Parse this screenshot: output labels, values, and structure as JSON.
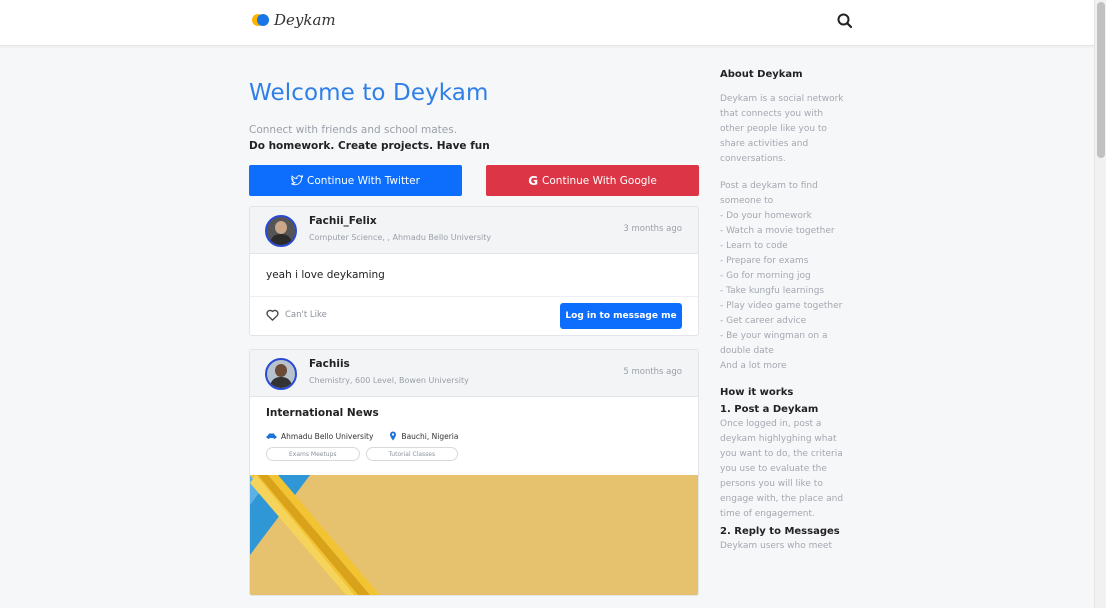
{
  "brand": {
    "name": "Deykam"
  },
  "header": {
    "search_icon": "search-icon"
  },
  "hero": {
    "title": "Welcome to Deykam",
    "tagline": "Connect with friends and school mates.",
    "tagline_bold": "Do homework. Create projects. Have fun"
  },
  "auth": {
    "twitter_label": "Continue With Twitter",
    "google_label": "Continue With Google"
  },
  "posts": [
    {
      "username": "Fachii_Felix",
      "meta": "Computer Science, , Ahmadu Bello University",
      "time": "3 months ago",
      "text": "yeah i love deykaming",
      "like_label": "Can't Like",
      "message_label": "Log in to message me"
    },
    {
      "username": "Fachiis",
      "meta": "Chemistry, 600 Level, Bowen University",
      "time": "5 months ago",
      "title": "International News",
      "school": "Ahmadu Bello University",
      "location": "Bauchi, Nigeria",
      "tags": [
        "Exams Meetups",
        "Tutorial Classes"
      ]
    }
  ],
  "sidebar": {
    "about_title": "About Deykam",
    "about_text": "Deykam is a social network that connects you with other people like you to share activities and conversations.",
    "post_intro": "Post a deykam to find someone to",
    "list": [
      "- Do your homework",
      "- Watch a movie together",
      "- Learn to code",
      "- Prepare for exams",
      "- Go for morning jog",
      "- Take kungfu learnings",
      "- Play video game together",
      "- Get career advice",
      "- Be your wingman on a double date",
      "And a lot more"
    ],
    "how_title": "How it works",
    "step1_title": "1. Post a Deykam",
    "step1_text": "Once logged in, post a deykam highlyghing what you want to do, the criteria you use to evaluate the persons you will like to engage with, the place and time of engagement.",
    "step2_title": "2. Reply to Messages",
    "step2_text": "Deykam users who meet"
  },
  "colors": {
    "accent": "#2f7fe6",
    "twitter": "#0d6efd",
    "google": "#dc3545"
  }
}
